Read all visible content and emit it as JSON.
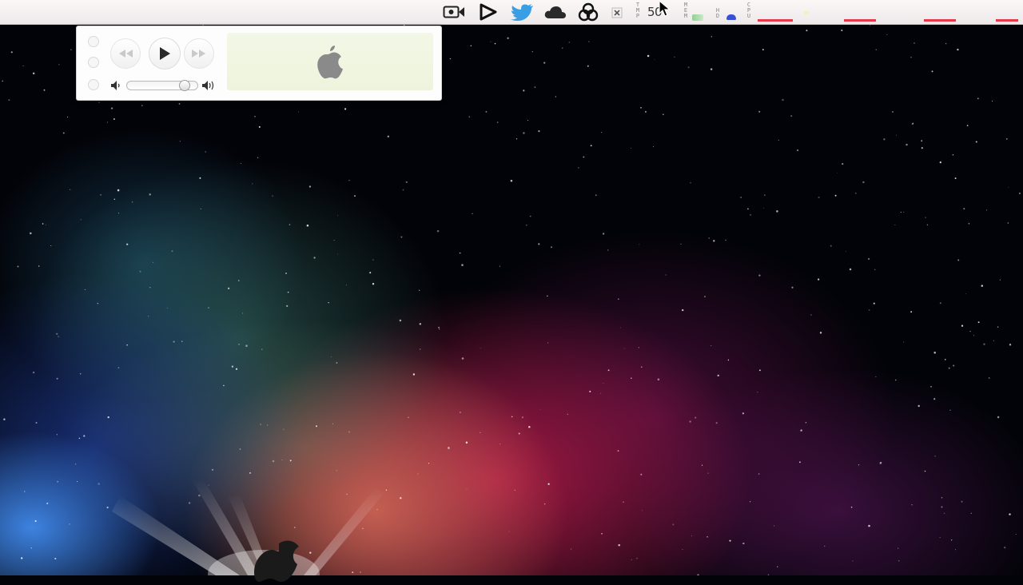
{
  "menubar": {
    "items": [
      {
        "icon": "video-camera-icon"
      },
      {
        "icon": "play-icon"
      },
      {
        "icon": "twitter-bird-icon"
      },
      {
        "icon": "cloud-icon"
      },
      {
        "icon": "recycle-icon"
      },
      {
        "icon": "close-box-icon"
      }
    ],
    "cpu_readout": "50",
    "mini_labels": [
      {
        "letters": [
          "T",
          "M",
          "P"
        ]
      },
      {
        "letters": [
          "M",
          "E",
          "M"
        ]
      },
      {
        "letters": [
          "H",
          "D"
        ]
      },
      {
        "letters": [
          "C",
          "P",
          "U"
        ]
      }
    ],
    "colors": {
      "graph": "#e8394a",
      "bar_bg": "#f4f0f0"
    }
  },
  "player": {
    "window_buttons": [
      "close-button",
      "minimize-button",
      "zoom-button"
    ],
    "transport": [
      "rewind-icon",
      "play-icon",
      "fast-forward-icon"
    ],
    "volume_level": 0.86,
    "lcd_icon": "apple-logo-icon",
    "colors": {
      "lcd": "#f0f5df",
      "apple": "#8a8a8a"
    }
  },
  "desktop": {
    "wallpaper_icon": "apple-logo-icon"
  }
}
